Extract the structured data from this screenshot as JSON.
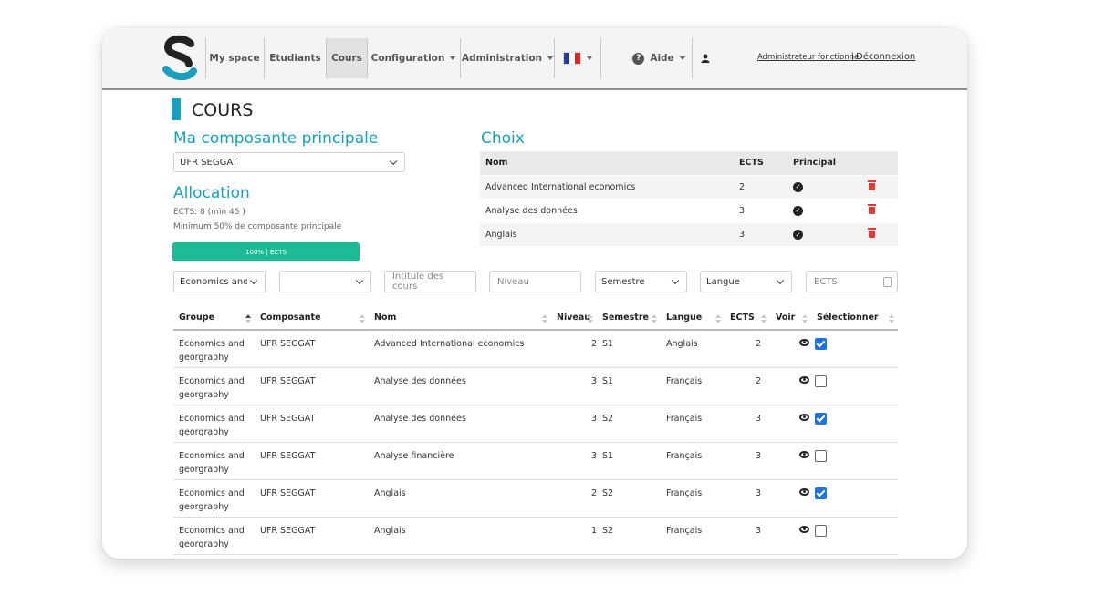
{
  "nav": {
    "items": [
      "My space",
      "Etudiants",
      "Cours",
      "Configuration",
      "Administration"
    ],
    "help": "Aide",
    "user": "Administrateur fonctionnel",
    "separator": "|",
    "logout": "Déconnexion",
    "flag_colors": [
      "#1f3ea8",
      "#ffffff",
      "#d62828"
    ]
  },
  "page": {
    "title": "COURS"
  },
  "main_component": {
    "heading": "Ma composante principale",
    "selected": "UFR SEGGAT"
  },
  "allocation": {
    "heading": "Allocation",
    "ects_text": "ECTS: 8 (min 45 )",
    "minimum_text": "Minimum 50% de composante principale",
    "progress_label": "100% | ECTS",
    "progress_fraction": 1.0
  },
  "choix": {
    "heading": "Choix",
    "columns": [
      "Nom",
      "ECTS",
      "Principal"
    ],
    "rows": [
      {
        "nom": "Advanced International economics",
        "ects": "2"
      },
      {
        "nom": "Analyse des données",
        "ects": "3"
      },
      {
        "nom": "Anglais",
        "ects": "3"
      }
    ]
  },
  "filters": {
    "groupe": "Economics and g",
    "composante": "",
    "intitule_placeholder": "Intitulé des cours",
    "niveau_placeholder": "Niveau",
    "semestre": "Semestre",
    "langue": "Langue",
    "ects_placeholder": "ECTS"
  },
  "table": {
    "columns": [
      "Groupe",
      "Composante",
      "Nom",
      "Niveau",
      "Semestre",
      "Langue",
      "ECTS",
      "Voir",
      "Sélectionner"
    ],
    "rows": [
      {
        "groupe": "Economics and georgraphy",
        "composante": "UFR SEGGAT",
        "nom": "Advanced International economics",
        "niveau": "2",
        "semestre": "S1",
        "langue": "Anglais",
        "ects": "2",
        "selected": true
      },
      {
        "groupe": "Economics and georgraphy",
        "composante": "UFR SEGGAT",
        "nom": "Analyse des données",
        "niveau": "3",
        "semestre": "S1",
        "langue": "Français",
        "ects": "2",
        "selected": false
      },
      {
        "groupe": "Economics and georgraphy",
        "composante": "UFR SEGGAT",
        "nom": "Analyse des données",
        "niveau": "3",
        "semestre": "S2",
        "langue": "Français",
        "ects": "3",
        "selected": true
      },
      {
        "groupe": "Economics and georgraphy",
        "composante": "UFR SEGGAT",
        "nom": "Analyse financière",
        "niveau": "3",
        "semestre": "S1",
        "langue": "Français",
        "ects": "3",
        "selected": false
      },
      {
        "groupe": "Economics and georgraphy",
        "composante": "UFR SEGGAT",
        "nom": "Anglais",
        "niveau": "2",
        "semestre": "S2",
        "langue": "Français",
        "ects": "3",
        "selected": true
      },
      {
        "groupe": "Economics and georgraphy",
        "composante": "UFR SEGGAT",
        "nom": "Anglais",
        "niveau": "1",
        "semestre": "S2",
        "langue": "Français",
        "ects": "3",
        "selected": false
      }
    ]
  }
}
